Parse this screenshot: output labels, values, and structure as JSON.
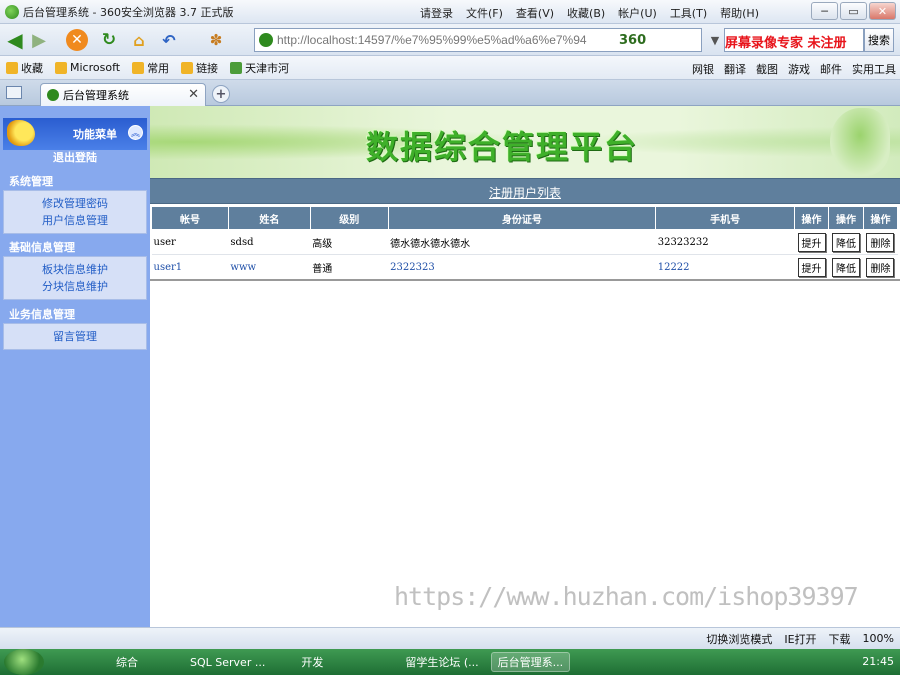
{
  "window": {
    "title": "后台管理系统 - 360安全浏览器 3.7 正式版",
    "menus": [
      "请登录",
      "文件(F)",
      "查看(V)",
      "收藏(B)",
      "帐户(U)",
      "工具(T)",
      "帮助(H)"
    ]
  },
  "address": {
    "url": "http://localhost:14597/%e7%95%99%e5%ad%a6%e7%94",
    "brand": "360",
    "search_watermark": "屏幕录像专家  未注册",
    "search_button": "搜索"
  },
  "favorites": {
    "items": [
      "收藏",
      "Microsoft",
      "常用",
      "链接",
      "天津市河"
    ],
    "tools": [
      "网银",
      "翻译",
      "截图",
      "游戏",
      "邮件",
      "实用工具"
    ]
  },
  "tab": {
    "label": "后台管理系统"
  },
  "sidebar": {
    "header": "功能菜单",
    "logout": "退出登陆",
    "groups": [
      {
        "title": "系统管理",
        "links": [
          "修改管理密码",
          "用户信息管理"
        ]
      },
      {
        "title": "基础信息管理",
        "links": [
          "板块信息维护",
          "分块信息维护"
        ]
      },
      {
        "title": "业务信息管理",
        "links": [
          "留言管理"
        ]
      }
    ]
  },
  "banner": {
    "title": "数据综合管理平台"
  },
  "list": {
    "title": "注册用户列表",
    "headers": [
      "帐号",
      "姓名",
      "级别",
      "身份证号",
      "手机号",
      "操作",
      "操作",
      "操作"
    ],
    "rows": [
      {
        "account": "user",
        "name": "sdsd",
        "level": "高级",
        "id_number": "德水德水德水德水",
        "phone": "32323232",
        "actions": [
          "提升",
          "降低",
          "删除"
        ]
      },
      {
        "account": "user1",
        "name": "www",
        "level": "普通",
        "id_number": "2322323",
        "phone": "12222",
        "actions": [
          "提升",
          "降低",
          "删除"
        ]
      }
    ]
  },
  "watermark": "https://www.huzhan.com/ishop39397",
  "statusbar": [
    "切换浏览模式",
    "IE打开",
    "下载",
    "100%"
  ],
  "taskbar": {
    "items": [
      "综合",
      "SQL Server ...",
      "开发",
      "留学生论坛 (...",
      "后台管理系..."
    ],
    "clock": "21:45"
  }
}
